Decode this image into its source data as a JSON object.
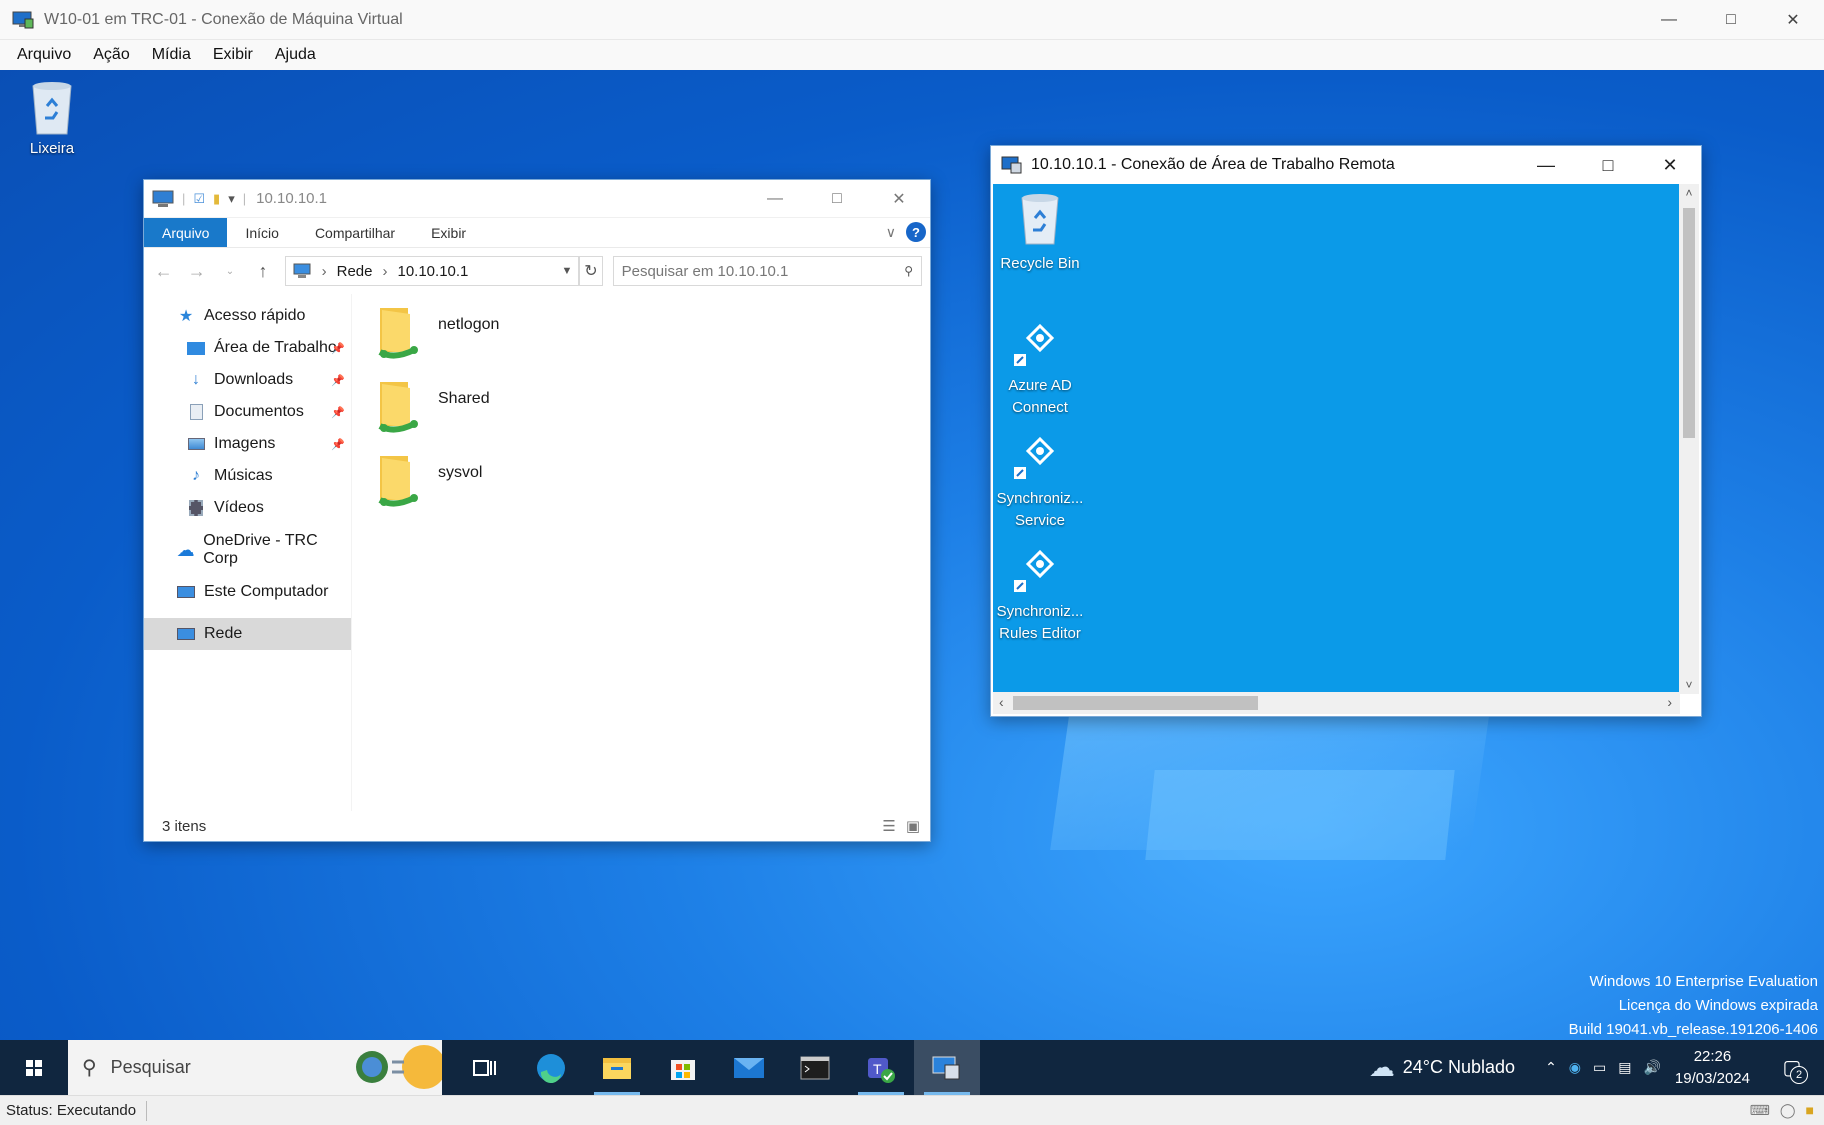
{
  "host": {
    "title": "W10-01 em TRC-01 - Conexão de Máquina Virtual",
    "menu": [
      "Arquivo",
      "Ação",
      "Mídia",
      "Exibir",
      "Ajuda"
    ],
    "status": "Status: Executando"
  },
  "desktop": {
    "icons": [
      {
        "label": "Lixeira",
        "icon": "recycle-bin-icon"
      }
    ],
    "watermark": [
      "Windows 10 Enterprise Evaluation",
      "Licença do Windows expirada",
      "Build 19041.vb_release.191206-1406"
    ]
  },
  "explorer": {
    "title": "10.10.10.1",
    "ribbon_tabs": [
      "Arquivo",
      "Início",
      "Compartilhar",
      "Exibir"
    ],
    "address": {
      "root": "Rede",
      "current": "10.10.10.1"
    },
    "search_placeholder": "Pesquisar em 10.10.10.1",
    "nav": {
      "quick_access": "Acesso rápido",
      "pinned": [
        "Área de Trabalho",
        "Downloads",
        "Documentos",
        "Imagens"
      ],
      "unpinned": [
        "Músicas",
        "Vídeos"
      ],
      "onedrive": "OneDrive - TRC Corp",
      "this_pc": "Este Computador",
      "network": "Rede"
    },
    "items": [
      "netlogon",
      "Shared",
      "sysvol"
    ],
    "status": "3 itens"
  },
  "rdp": {
    "title": "10.10.10.1 - Conexão de Área de Trabalho Remota",
    "icons": [
      {
        "line1": "Recycle Bin",
        "line2": ""
      },
      {
        "line1": "Azure AD",
        "line2": "Connect"
      },
      {
        "line1": "Synchroniz...",
        "line2": "Service"
      },
      {
        "line1": "Synchroniz...",
        "line2": "Rules Editor"
      }
    ]
  },
  "taskbar": {
    "search_placeholder": "Pesquisar",
    "apps": [
      "task-view-icon",
      "edge-icon",
      "file-explorer-icon",
      "store-icon",
      "mail-icon",
      "terminal-icon",
      "teams-icon",
      "remote-desktop-icon"
    ],
    "weather": "24°C  Nublado",
    "time": "22:26",
    "date": "19/03/2024",
    "notifications": "2"
  }
}
